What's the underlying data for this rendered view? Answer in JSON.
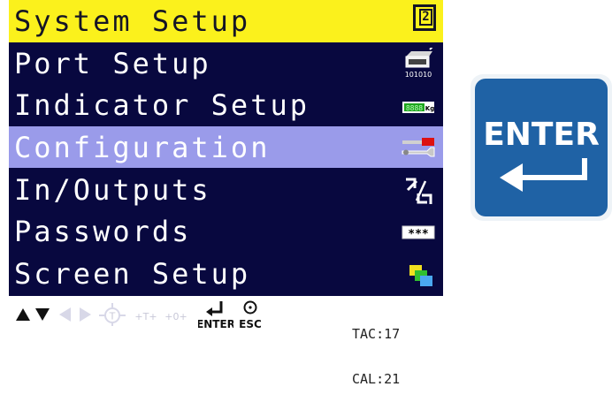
{
  "title_bar": {
    "title": "System Setup",
    "page_number": "2"
  },
  "menu": {
    "items": [
      {
        "label": "Port Setup",
        "icon": "serial-port-icon",
        "icon_caption": "101010",
        "selected": false
      },
      {
        "label": "Indicator Setup",
        "icon": "indicator-display-icon",
        "icon_caption": "8888",
        "icon_unit": "Kg",
        "selected": false
      },
      {
        "label": "Configuration",
        "icon": "wrenches-icon",
        "selected": true
      },
      {
        "label": "In/Outputs",
        "icon": "in-out-icon",
        "selected": false
      },
      {
        "label": "Passwords",
        "icon": "password-icon",
        "icon_caption": "***",
        "selected": false
      },
      {
        "label": "Screen Setup",
        "icon": "screens-icon",
        "selected": false
      }
    ]
  },
  "footer": {
    "keys": [
      {
        "icon": "arrow-up-icon",
        "enabled": true
      },
      {
        "icon": "arrow-down-icon",
        "enabled": true
      },
      {
        "icon": "arrow-left-icon",
        "enabled": false
      },
      {
        "icon": "arrow-right-icon",
        "enabled": false
      },
      {
        "icon": "tare-icon",
        "label": "T",
        "enabled": false
      },
      {
        "icon": "tare-plus-icon",
        "label": "+T+",
        "enabled": false
      },
      {
        "icon": "zero-icon",
        "label": "+0+",
        "enabled": false
      },
      {
        "icon": "enter-icon",
        "label": "ENTER",
        "enabled": true
      },
      {
        "icon": "escape-icon",
        "label": "ESC",
        "enabled": true
      }
    ],
    "status": {
      "tac": "TAC:17",
      "cal": "CAL:21"
    }
  },
  "enter_key": {
    "label": "ENTER",
    "icon": "return-arrow-icon"
  },
  "colors": {
    "title_bg": "#fbf11c",
    "menu_bg": "#08083f",
    "selected_bg": "#9a9bea",
    "menu_text": "#ffffff",
    "enter_key_bg": "#1f62a5"
  }
}
